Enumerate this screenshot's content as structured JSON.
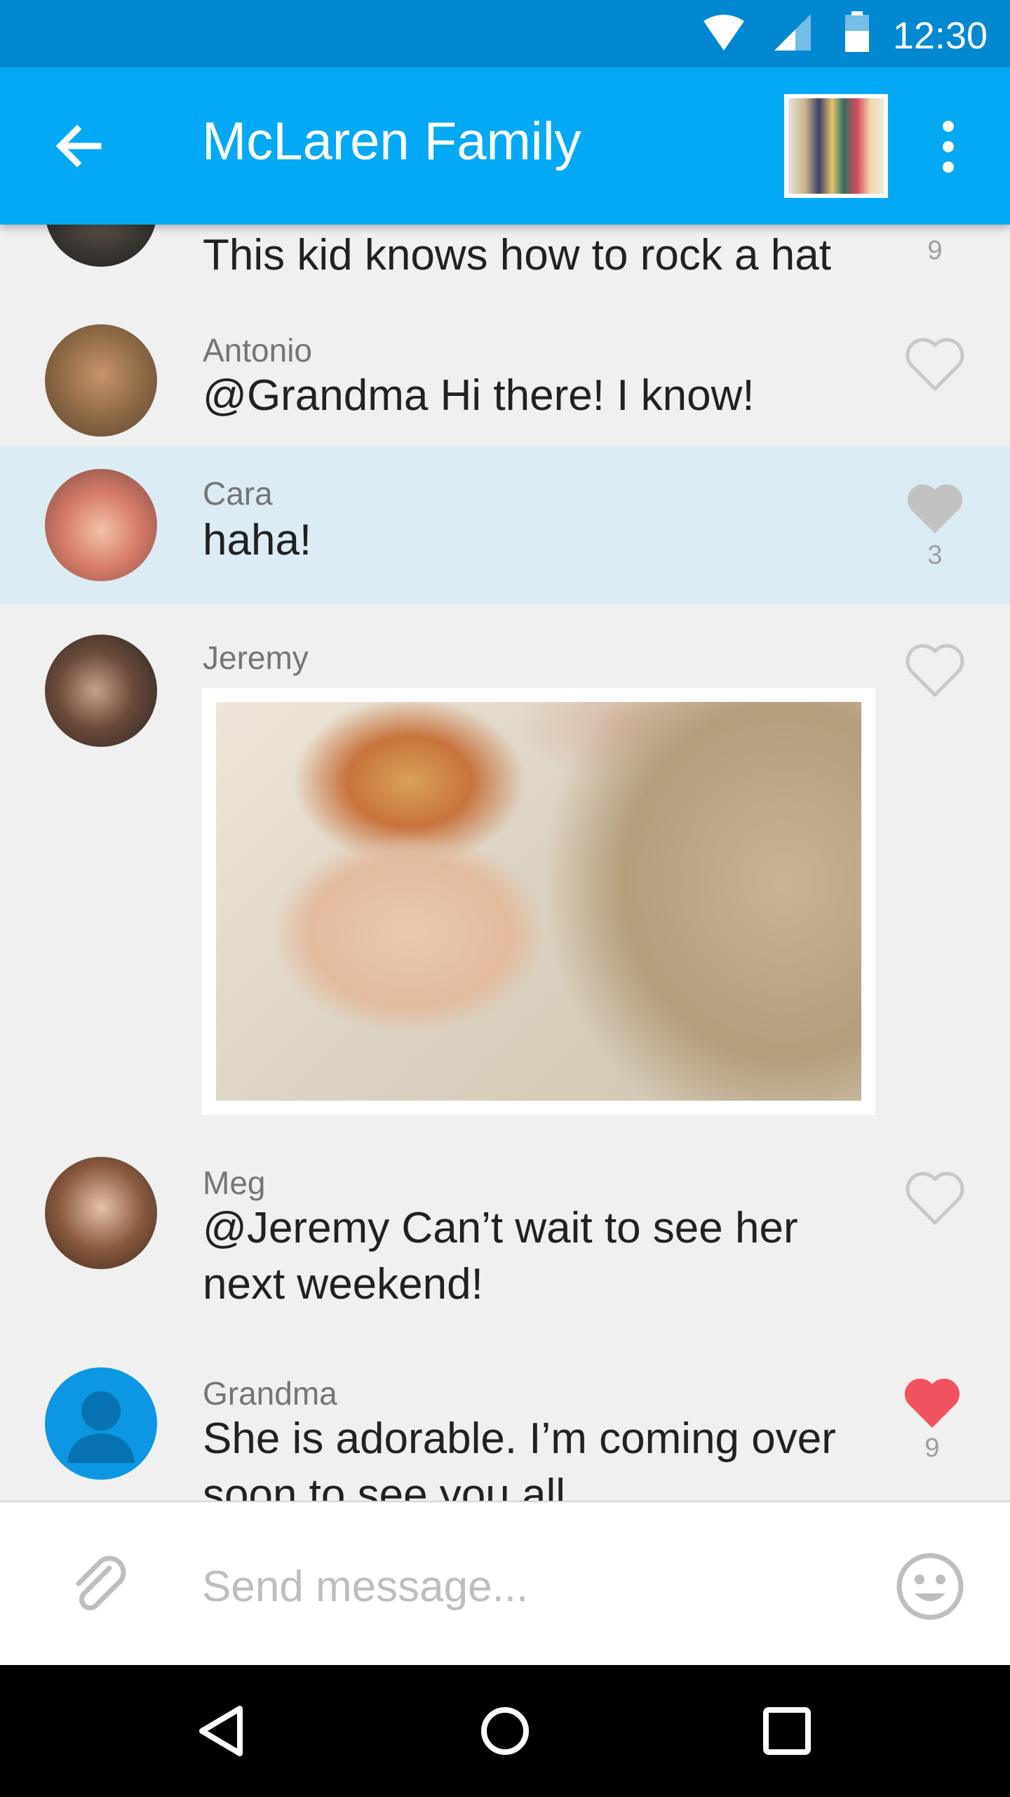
{
  "status_bar": {
    "time": "12:30"
  },
  "app_bar": {
    "title": "McLaren Family"
  },
  "messages": [
    {
      "text": "This kid knows how to rock a hat",
      "likes": "9"
    },
    {
      "sender": "Antonio",
      "text": "@Grandma Hi there! I know!"
    },
    {
      "sender": "Cara",
      "text": "haha!",
      "likes": "3"
    },
    {
      "sender": "Jeremy"
    },
    {
      "sender": "Meg",
      "text": "@Jeremy Can’t wait to see her next weekend!"
    },
    {
      "sender": "Grandma",
      "text": "She is adorable. I’m coming over soon to see you all",
      "likes": "9"
    }
  ],
  "composer": {
    "placeholder": "Send message..."
  },
  "colors": {
    "status_bar": "#0288d1",
    "app_bar": "#03a9f4",
    "highlight_row": "#dbecf4",
    "liked_heart": "#f0535f",
    "grey_heart": "#c2c2c2"
  },
  "icons": {
    "back": "back-arrow-icon",
    "overflow": "more-vert-icon",
    "like": "heart-icon",
    "attach": "paperclip-icon",
    "emoji": "emoji-icon"
  }
}
